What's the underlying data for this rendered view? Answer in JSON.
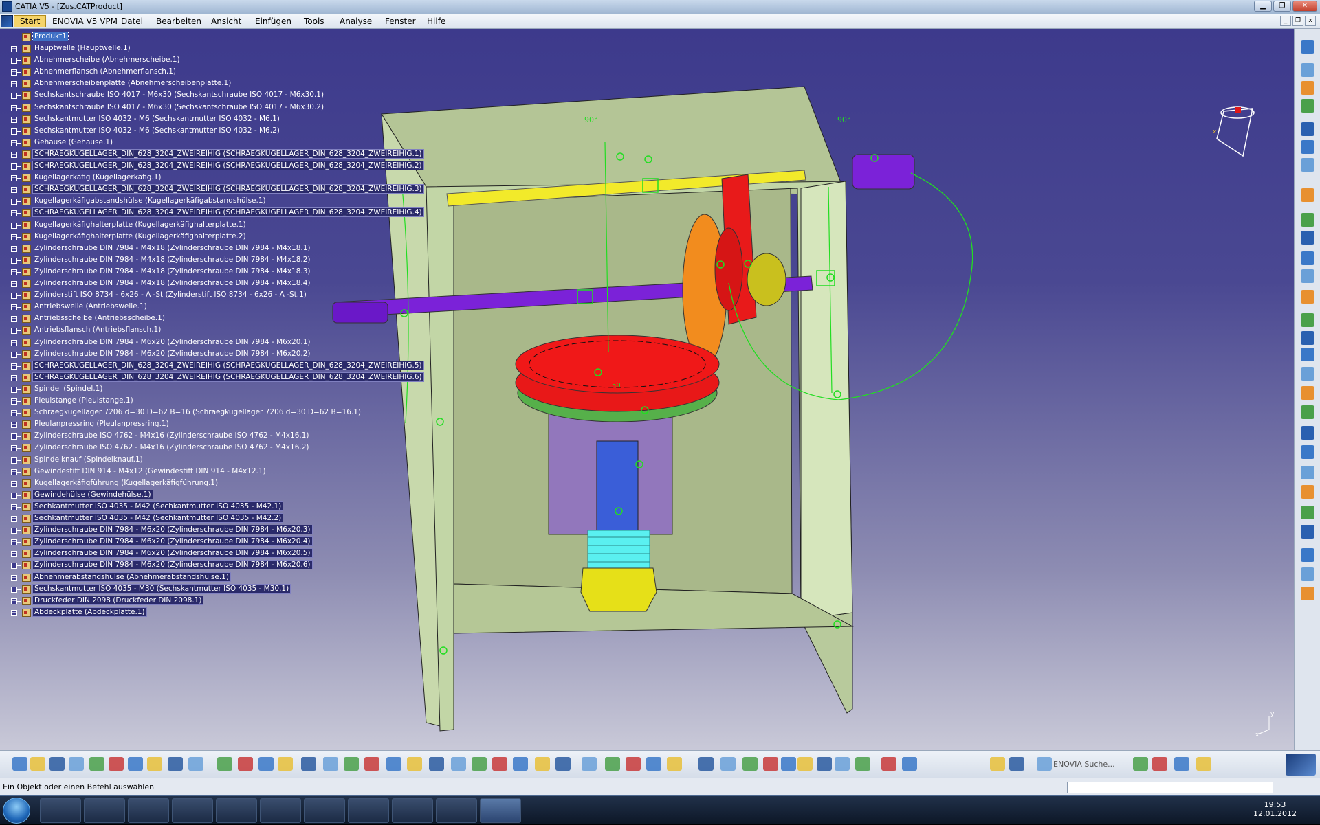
{
  "window": {
    "title": "CATIA V5 - [Zus.CATProduct]"
  },
  "menu": {
    "items": [
      "Start",
      "ENOVIA V5 VPM",
      "Datei",
      "Bearbeiten",
      "Ansicht",
      "Einfügen",
      "Tools",
      "Analyse",
      "Fenster",
      "Hilfe"
    ]
  },
  "tree": {
    "root": "Produkt1",
    "items": [
      {
        "label": "Hauptwelle (Hauptwelle.1)",
        "hl": false
      },
      {
        "label": "Abnehmerscheibe (Abnehmerscheibe.1)",
        "hl": false
      },
      {
        "label": "Abnehmerflansch (Abnehmerflansch.1)",
        "hl": false
      },
      {
        "label": "Abnehmerscheibenplatte (Abnehmerscheibenplatte.1)",
        "hl": false
      },
      {
        "label": "Sechskantschraube ISO 4017 - M6x30 (Sechskantschraube ISO 4017 - M6x30.1)",
        "hl": false
      },
      {
        "label": "Sechskantschraube ISO 4017 - M6x30 (Sechskantschraube ISO 4017 - M6x30.2)",
        "hl": false
      },
      {
        "label": "Sechskantmutter ISO 4032 - M6 (Sechskantmutter ISO 4032 - M6.1)",
        "hl": false
      },
      {
        "label": "Sechskantmutter ISO 4032 - M6 (Sechskantmutter ISO 4032 - M6.2)",
        "hl": false
      },
      {
        "label": "Gehäuse (Gehäuse.1)",
        "hl": false
      },
      {
        "label": "SCHRAEGKUGELLAGER_DIN_628_3204_ZWEIREIHIG (SCHRAEGKUGELLAGER_DIN_628_3204_ZWEIREIHIG.1)",
        "hl": true
      },
      {
        "label": "SCHRAEGKUGELLAGER_DIN_628_3204_ZWEIREIHIG (SCHRAEGKUGELLAGER_DIN_628_3204_ZWEIREIHIG.2)",
        "hl": true
      },
      {
        "label": "Kugellagerkäfig (Kugellagerkäfig.1)",
        "hl": false
      },
      {
        "label": "SCHRAEGKUGELLAGER_DIN_628_3204_ZWEIREIHIG (SCHRAEGKUGELLAGER_DIN_628_3204_ZWEIREIHIG.3)",
        "hl": true
      },
      {
        "label": "Kugellagerkäfigabstandshülse (Kugellagerkäfigabstandshülse.1)",
        "hl": false
      },
      {
        "label": "SCHRAEGKUGELLAGER_DIN_628_3204_ZWEIREIHIG (SCHRAEGKUGELLAGER_DIN_628_3204_ZWEIREIHIG.4)",
        "hl": true
      },
      {
        "label": "Kugellagerkäfighalterplatte (Kugellagerkäfighalterplatte.1)",
        "hl": false
      },
      {
        "label": "Kugellagerkäfighalterplatte (Kugellagerkäfighalterplatte.2)",
        "hl": false
      },
      {
        "label": "Zylinderschraube DIN  7984 - M4x18 (Zylinderschraube DIN  7984 - M4x18.1)",
        "hl": false
      },
      {
        "label": "Zylinderschraube DIN  7984 - M4x18 (Zylinderschraube DIN  7984 - M4x18.2)",
        "hl": false
      },
      {
        "label": "Zylinderschraube DIN  7984 - M4x18 (Zylinderschraube DIN  7984 - M4x18.3)",
        "hl": false
      },
      {
        "label": "Zylinderschraube DIN  7984 - M4x18 (Zylinderschraube DIN  7984 - M4x18.4)",
        "hl": false
      },
      {
        "label": "Zylinderstift ISO 8734 - 6x26 - A -St (Zylinderstift ISO 8734 - 6x26 - A -St.1)",
        "hl": false
      },
      {
        "label": "Antriebswelle (Antriebswelle.1)",
        "hl": false
      },
      {
        "label": "Antriebsscheibe (Antriebsscheibe.1)",
        "hl": false
      },
      {
        "label": "Antriebsflansch (Antriebsflansch.1)",
        "hl": false
      },
      {
        "label": "Zylinderschraube DIN  7984 - M6x20 (Zylinderschraube DIN  7984 - M6x20.1)",
        "hl": false
      },
      {
        "label": "Zylinderschraube DIN  7984 - M6x20 (Zylinderschraube DIN  7984 - M6x20.2)",
        "hl": false
      },
      {
        "label": "SCHRAEGKUGELLAGER_DIN_628_3204_ZWEIREIHIG (SCHRAEGKUGELLAGER_DIN_628_3204_ZWEIREIHIG.5)",
        "hl": true
      },
      {
        "label": "SCHRAEGKUGELLAGER_DIN_628_3204_ZWEIREIHIG (SCHRAEGKUGELLAGER_DIN_628_3204_ZWEIREIHIG.6)",
        "hl": true
      },
      {
        "label": "Spindel (Spindel.1)",
        "hl": false
      },
      {
        "label": "Pleulstange (Pleulstange.1)",
        "hl": false
      },
      {
        "label": "Schraegkugellager 7206 d=30 D=62 B=16 (Schraegkugellager 7206 d=30 D=62 B=16.1)",
        "hl": false
      },
      {
        "label": "Pleulanpressring (Pleulanpressring.1)",
        "hl": false
      },
      {
        "label": "Zylinderschraube ISO 4762 - M4x16 (Zylinderschraube ISO 4762 - M4x16.1)",
        "hl": false
      },
      {
        "label": "Zylinderschraube ISO 4762 - M4x16 (Zylinderschraube ISO 4762 - M4x16.2)",
        "hl": false
      },
      {
        "label": "Spindelknauf (Spindelknauf.1)",
        "hl": false
      },
      {
        "label": "Gewindestift DIN 914 - M4x12 (Gewindestift DIN 914 - M4x12.1)",
        "hl": false
      },
      {
        "label": "Kugellagerkäfigführung (Kugellagerkäfigführung.1)",
        "hl": false
      },
      {
        "label": "Gewindehülse (Gewindehülse.1)",
        "hl": true
      },
      {
        "label": "Sechkantmutter ISO 4035 - M42 (Sechkantmutter ISO 4035 - M42.1)",
        "hl": true
      },
      {
        "label": "Sechkantmutter ISO 4035 - M42 (Sechkantmutter ISO 4035 - M42.2)",
        "hl": true
      },
      {
        "label": "Zylinderschraube DIN  7984 - M6x20 (Zylinderschraube DIN  7984 - M6x20.3)",
        "hl": true
      },
      {
        "label": "Zylinderschraube DIN  7984 - M6x20 (Zylinderschraube DIN  7984 - M6x20.4)",
        "hl": true
      },
      {
        "label": "Zylinderschraube DIN  7984 - M6x20 (Zylinderschraube DIN  7984 - M6x20.5)",
        "hl": true
      },
      {
        "label": "Zylinderschraube DIN  7984 - M6x20 (Zylinderschraube DIN  7984 - M6x20.6)",
        "hl": true
      },
      {
        "label": "Abnehmerabstandshülse (Abnehmerabstandshülse.1)",
        "hl": true
      },
      {
        "label": "Sechskantmutter ISO 4035 - M30 (Sechskantmutter ISO 4035 - M30.1)",
        "hl": true
      },
      {
        "label": "Druckfeder DIN 2098 (Druckfeder DIN 2098.1)",
        "hl": true
      },
      {
        "label": "Abdeckplatte (Abdeckplatte.1)",
        "hl": true
      }
    ]
  },
  "annotations": {
    "angle1": "90°",
    "angle2": "90°",
    "angle3": "50"
  },
  "toolbar": {
    "enovia_search": "ENOVIA Suche..."
  },
  "status": {
    "message": "Ein Objekt oder einen Befehl auswählen"
  },
  "taskbar": {
    "time": "19:53",
    "date": "12.01.2012"
  },
  "colors": {
    "viewport_top": "#3d3a8c",
    "housing": "#c2d6a6",
    "shaft_yellow": "#f2ea2a",
    "shaft_purple": "#7b22d8",
    "disc_red": "#f01818",
    "disc_orange": "#f28c1e",
    "spring_cyan": "#5af0f0",
    "constraint_green": "#22dd22"
  }
}
